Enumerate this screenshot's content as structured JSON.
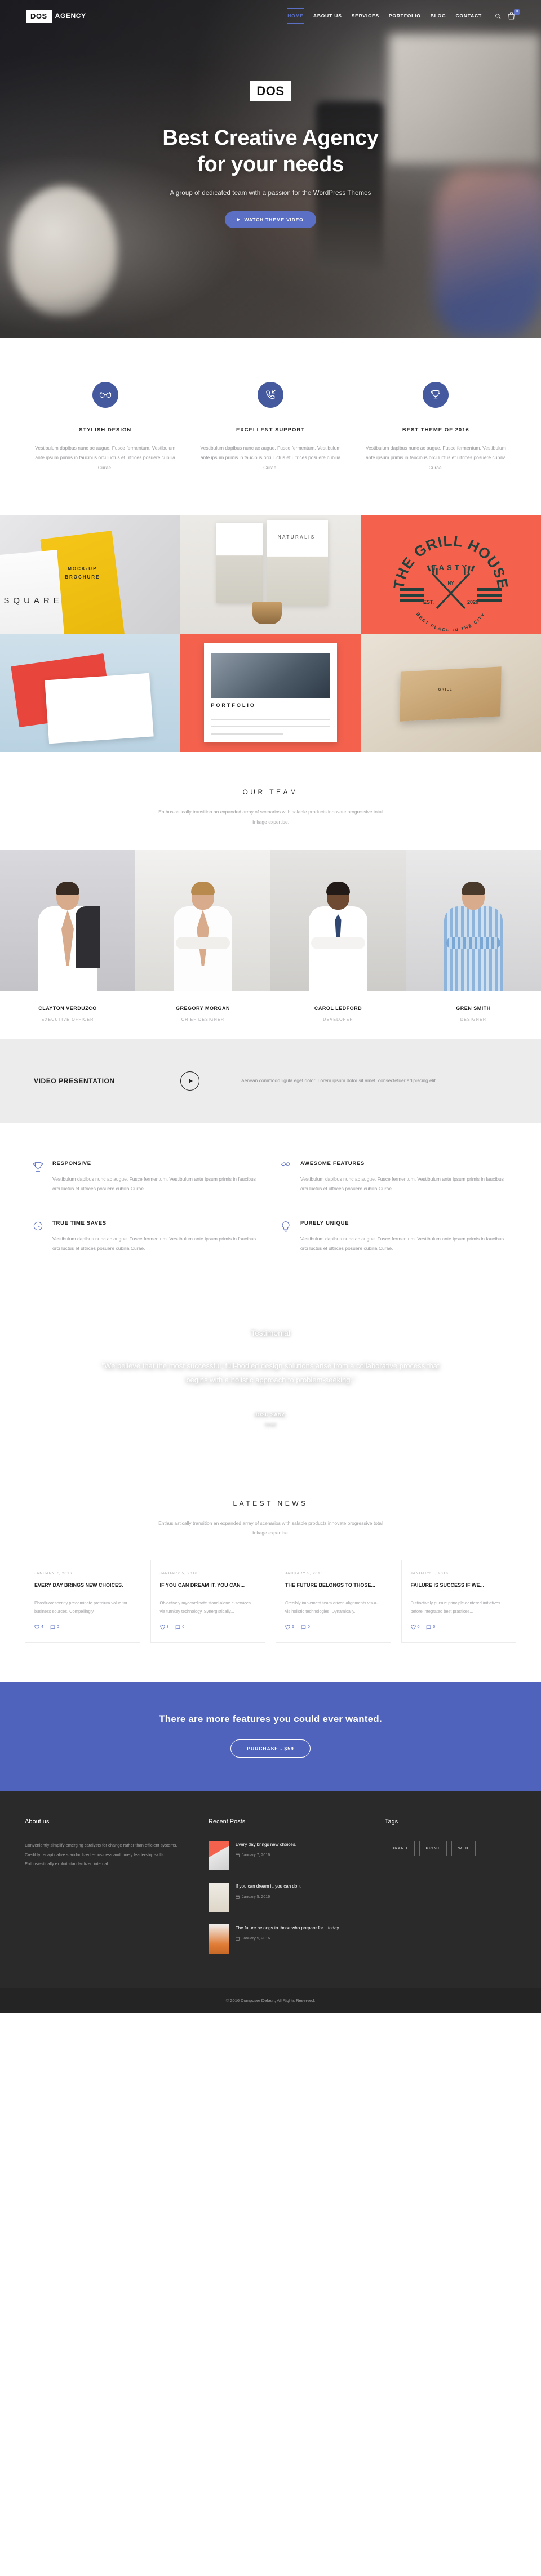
{
  "nav": {
    "logo_mark": "DOS",
    "logo_text": "AGENCY",
    "items": [
      {
        "label": "HOME",
        "active": true
      },
      {
        "label": "ABOUT US",
        "active": false
      },
      {
        "label": "SERVICES",
        "active": false
      },
      {
        "label": "PORTFOLIO",
        "active": false
      },
      {
        "label": "BLOG",
        "active": false
      },
      {
        "label": "CONTACT",
        "active": false
      }
    ],
    "search_icon": "search-icon",
    "cart_icon": "shopping-bag-icon",
    "cart_count": "0"
  },
  "hero": {
    "logo": "DOS",
    "title_line1": "Best Creative Agency",
    "title_line2": "for your needs",
    "subtitle": "A group of dedicated team with a passion for the WordPress Themes",
    "button": "WATCH THEME VIDEO"
  },
  "services": [
    {
      "icon": "glasses-icon",
      "title": "STYLISH DESIGN",
      "text": "Vestibulum dapibus nunc ac augue. Fusce fermentum. Vestibulum ante ipsum primis in faucibus orci luctus et ultrices posuere cubilia Curae."
    },
    {
      "icon": "phone-incoming-icon",
      "title": "EXCELLENT SUPPORT",
      "text": "Vestibulum dapibus nunc ac augue. Fusce fermentum. Vestibulum ante ipsum primis in faucibus orci luctus et ultrices posuere cubilia Curae."
    },
    {
      "icon": "trophy-icon",
      "title": "BEST THEME OF 2016",
      "text": "Vestibulum dapibus nunc ac augue. Fusce fermentum. Vestibulum ante ipsum primis in faucibus orci luctus et ultrices posuere cubilia Curae."
    }
  ],
  "portfolio": {
    "item1_label": "SQUARE",
    "item1_sub": "MOCK-UP\nBROCHURE",
    "item2_label": "NATURALIS",
    "item3_top": "THE GRILL HOUSE",
    "item3_mid": "TASTY",
    "item3_city": "NY",
    "item3_est": "EST.",
    "item3_year": "2020",
    "item3_bottom": "BEST PLACE IN THE CITY",
    "item5_label": "PORTFOLIO",
    "item6_label": "GRILL"
  },
  "team_section": {
    "title": "OUR TEAM",
    "subtitle": "Enthusiastically transition an expanded array of scenarios with salable products innovate progressive total linkage expertise."
  },
  "team": [
    {
      "name": "CLAYTON VERDUZCO",
      "role": "EXECUTIVE OFFICER",
      "shirt": "#ffffff",
      "hair": "#3a2b22",
      "accent": "#2f2f33"
    },
    {
      "name": "GREGORY MORGAN",
      "role": "CHIEF DESIGNER",
      "shirt": "#fdfdfd",
      "hair": "#b98a4e",
      "accent": "#e8e6e2"
    },
    {
      "name": "CAROL LEDFORD",
      "role": "DEVELOPER",
      "shirt": "#ffffff",
      "hair": "#211a16",
      "accent": "#2f4670"
    },
    {
      "name": "GREN SMITH",
      "role": "DESIGNER",
      "shirt": "#7ba7d4",
      "hair": "#4a3a2c",
      "accent": "#5b89bb"
    }
  ],
  "video": {
    "title": "VIDEO PRESENTATION",
    "play_icon": "play-icon",
    "text": "Aenean commodo ligula eget dolor. Lorem ipsum dolor sit amet, consectetuer adipiscing elit."
  },
  "features": [
    {
      "icon": "trophy-icon",
      "title": "RESPONSIVE",
      "text": "Vestibulum dapibus nunc ac augue. Fusce fermentum. Vestibulum ante ipsum primis in faucibus orci luctus et ultrices posuere cubilia Curae."
    },
    {
      "icon": "mustache-icon",
      "title": "AWESOME FEATURES",
      "text": "Vestibulum dapibus nunc ac augue. Fusce fermentum. Vestibulum ante ipsum primis in faucibus orci luctus et ultrices posuere cubilia Curae."
    },
    {
      "icon": "clock-icon",
      "title": "TRUE TIME SAVES",
      "text": "Vestibulum dapibus nunc ac augue. Fusce fermentum. Vestibulum ante ipsum primis in faucibus orci luctus et ultrices posuere cubilia Curae."
    },
    {
      "icon": "lightbulb-icon",
      "title": "PURELY UNIQUE",
      "text": "Vestibulum dapibus nunc ac augue. Fusce fermentum. Vestibulum ante ipsum primis in faucibus orci luctus et ultrices posuere cubilia Curae."
    }
  ],
  "testimonial": {
    "label": "Testimonial",
    "quote": "\"We believe that the most successful, full-bodied design solutions arise from a collaborative process that begins with a holistic approach to problem-seeking.\"",
    "author": "JOSU SANZ,",
    "company": "Innwit"
  },
  "news_section": {
    "title": "LATEST NEWS",
    "subtitle": "Enthusiastically transition an expanded array of scenarios with salable products innovate progressive total linkage expertise."
  },
  "news": [
    {
      "date": "JANUARY 7, 2016",
      "title": "EVERY DAY BRINGS NEW CHOICES.",
      "excerpt": "Phosfluorescently predominate premium value for business sources. Compellingly...",
      "likes": "4",
      "comments": "0"
    },
    {
      "date": "JANUARY 5, 2016",
      "title": "IF YOU CAN DREAM IT, YOU CAN...",
      "excerpt": "Objectively myocardinate stand-alone e-services via turnkey technology. Synergistically...",
      "likes": "3",
      "comments": "0"
    },
    {
      "date": "JANUARY 5, 2016",
      "title": "THE FUTURE BELONGS TO THOSE...",
      "excerpt": "Credibly implement team driven alignments vis-a-vis holistic technologies. Dynamically...",
      "likes": "6",
      "comments": "0"
    },
    {
      "date": "JANUARY 5, 2016",
      "title": "FAILURE IS SUCCESS IF WE...",
      "excerpt": "Distinctively pursue principle-centered initiatives before integrated best practices...",
      "likes": "0",
      "comments": "0"
    }
  ],
  "cta": {
    "title": "There are more features you could ever wanted.",
    "button": "PURCHASE - $59",
    "bg_color": "#4f63bd"
  },
  "footer": {
    "about_title": "About us",
    "about_text": "Conveniently simplify emerging catalysts for change rather than efficient systems. Credibly recaptiualize standardized e-business and timely leadership skills. Enthusiastically exploit standardized internal.",
    "recent_title": "Recent Posts",
    "recent_posts": [
      {
        "title": "Every day brings new choices.",
        "date": "January 7, 2016"
      },
      {
        "title": "If you can dream it, you can do it.",
        "date": "January 5, 2016"
      },
      {
        "title": "The future belongs to those who prepare for it today.",
        "date": "January 5, 2016"
      }
    ],
    "tags_title": "Tags",
    "tags": [
      "BRAND",
      "PRINT",
      "WEB"
    ],
    "copyright": "© 2016 Composer Default, All Rights Reserved."
  },
  "colors": {
    "accent": "#5b6fc4",
    "accent_dark": "#45599f",
    "cta": "#4f63bd",
    "footer_bg": "#2a2a2a",
    "coral": "#f4624e"
  }
}
